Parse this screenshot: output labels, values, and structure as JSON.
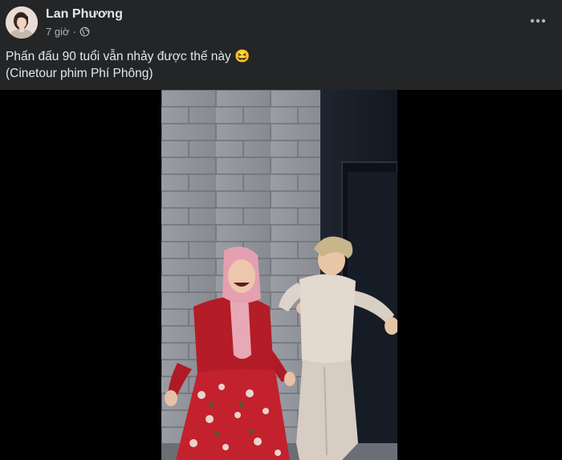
{
  "post": {
    "author": "Lan Phương",
    "time": "7 giờ",
    "separator": "·",
    "privacy_icon": "globe-icon",
    "more_icon": "more-options-icon",
    "caption_line1": "Phấn đấu 90 tuổi vẫn nhảy được thế này 😆",
    "caption_line2": "(Cinetour phim Phí Phông)"
  },
  "colors": {
    "background": "#242526",
    "primary_text": "#e4e6eb",
    "secondary_text": "#b0b3b8",
    "video_bg": "#000000"
  }
}
